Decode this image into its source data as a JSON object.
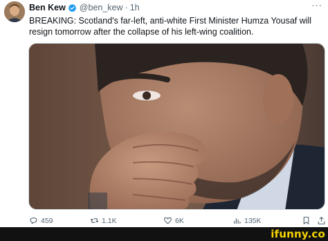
{
  "tweet": {
    "display_name": "Ben Kew",
    "handle": "@ben_kew",
    "separator": "·",
    "time": "1h",
    "more": "···",
    "text": "BREAKING: Scotland's far-left, anti-white First Minister Humza Yousaf will resign tomorrow after the collapse of his left-wing coalition."
  },
  "actions": {
    "replies": "459",
    "retweets": "1.1K",
    "likes": "6K",
    "views": "135K"
  },
  "icons": [
    "verified-badge-icon",
    "reply-icon",
    "retweet-icon",
    "like-icon",
    "views-icon",
    "bookmark-icon",
    "share-icon"
  ],
  "colors": {
    "verified": "#1d9bf0",
    "secondary_text": "#536471",
    "footer_bg": "#111111",
    "watermark": "#f5d400"
  },
  "watermark": "ifunny.co"
}
